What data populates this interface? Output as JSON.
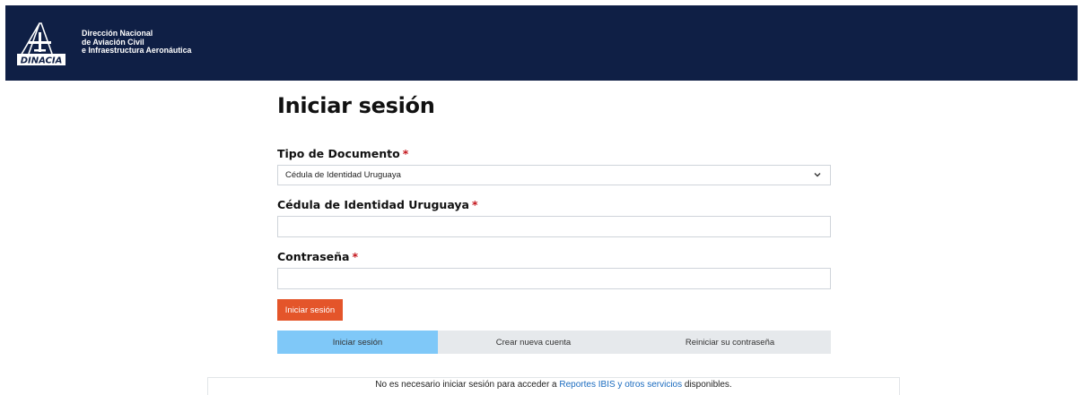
{
  "header": {
    "logo_text": "DINACIA",
    "brand_lines": [
      "Dirección Nacional",
      "de Aviación Civil",
      "e Infraestructura Aeronáutica"
    ],
    "bg_color": "#0f1f45"
  },
  "form": {
    "title": "Iniciar sesión",
    "doc_type": {
      "label": "Tipo de Documento",
      "required_mark": "*",
      "selected": "Cédula de Identidad Uruguaya",
      "icon": "chevron-down-icon"
    },
    "id_field": {
      "label": "Cédula de Identidad Uruguaya",
      "required_mark": "*",
      "value": ""
    },
    "password_field": {
      "label": "Contraseña",
      "required_mark": "*",
      "value": ""
    },
    "submit_label": "Iniciar sesión",
    "submit_color": "#e4552a"
  },
  "tabs": {
    "items": [
      "Iniciar sesión",
      "Crear nueva cuenta",
      "Reiniciar su contraseña"
    ],
    "active_index": 0,
    "active_color": "#7fc8f8"
  },
  "info": {
    "before": "No es necesario iniciar sesión para acceder a ",
    "link": "Reportes IBIS y otros servicios",
    "after": " disponibles."
  }
}
